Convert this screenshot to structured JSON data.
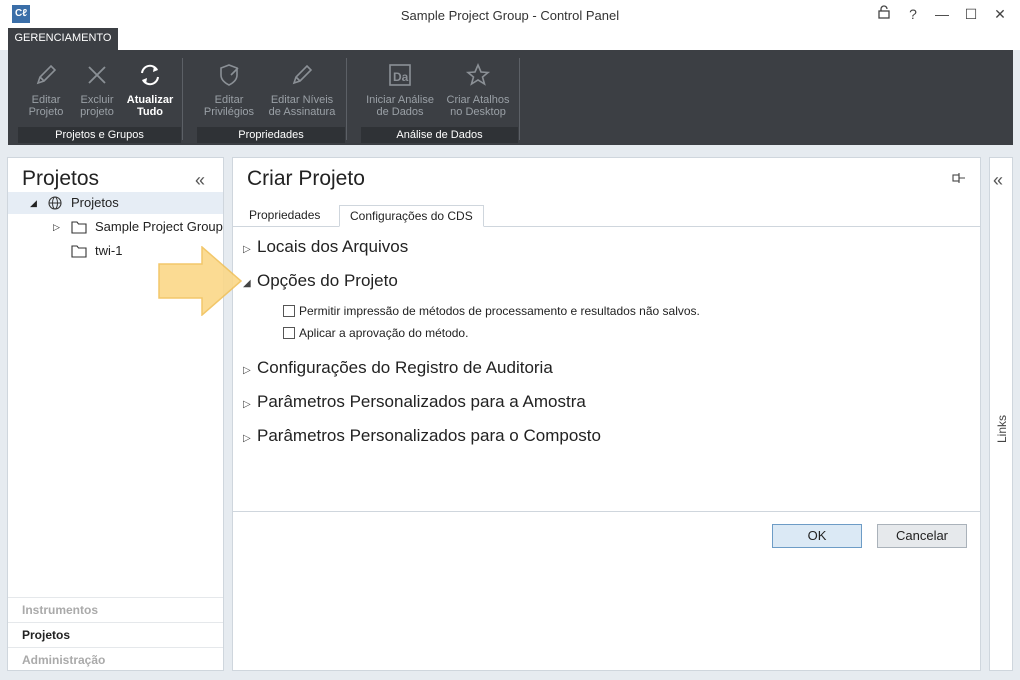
{
  "window": {
    "logo": "Cℓ",
    "title": "Sample Project Group - Control Panel",
    "controls": [
      "lock-icon",
      "help-icon",
      "minimize-icon",
      "maximize-icon",
      "close-icon"
    ]
  },
  "ribbon": {
    "tab": "GERENCIAMENTO",
    "groups": [
      {
        "label": "Projetos e Grupos",
        "buttons": [
          {
            "label1": "Editar",
            "label2": "Projeto",
            "icon": "pencil-icon"
          },
          {
            "label1": "Excluir",
            "label2": "projeto",
            "icon": "x-icon"
          },
          {
            "label1": "Atualizar",
            "label2": "Tudo",
            "icon": "refresh-icon"
          }
        ]
      },
      {
        "label": "Propriedades",
        "buttons": [
          {
            "label1": "Editar",
            "label2": "Privilégios",
            "icon": "shield-pencil-icon"
          },
          {
            "label1": "Editar Níveis",
            "label2": "de Assinatura",
            "icon": "pencil-icon"
          }
        ]
      },
      {
        "label": "Análise de Dados",
        "buttons": [
          {
            "label1": "Iniciar Análise",
            "label2": "de Dados",
            "icon": "data-analysis-icon"
          },
          {
            "label1": "Criar Atalhos",
            "label2": "no Desktop",
            "icon": "star-icon"
          }
        ]
      }
    ]
  },
  "left": {
    "title": "Projetos",
    "tree": {
      "root": "Projetos",
      "children": [
        "Sample Project Group",
        "twi-1"
      ]
    },
    "nav": [
      "Instrumentos",
      "Projetos",
      "Administração"
    ]
  },
  "main": {
    "title": "Criar Projeto",
    "tabs": [
      "Propriedades",
      "Configurações do CDS"
    ],
    "sections": [
      "Locais dos Arquivos",
      "Opções do Projeto",
      "Configurações do Registro de Auditoria",
      "Parâmetros Personalizados para a Amostra",
      "Parâmetros Personalizados para o Composto"
    ],
    "options": [
      "Permitir impressão de métodos de processamento e resultados não salvos.",
      "Aplicar a aprovação do método."
    ],
    "ok": "OK",
    "cancel": "Cancelar"
  },
  "right": {
    "label": "Links"
  }
}
